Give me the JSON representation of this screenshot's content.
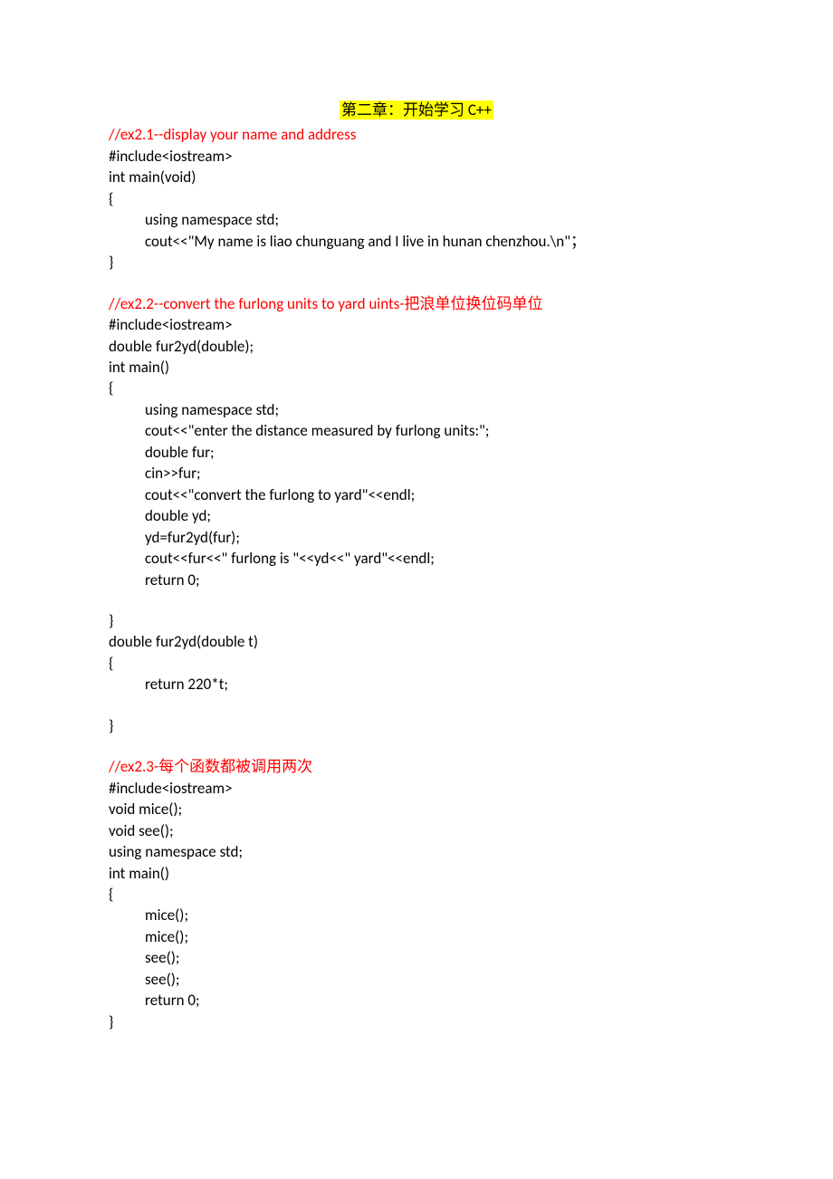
{
  "heading": "第二章：开始学习 C++",
  "sec1": {
    "title": "//ex2.1--display your name and address",
    "l1": "#include<iostream>",
    "l2": "int main(void)",
    "l3": "{",
    "l4": "using namespace std;",
    "l5": "cout<<\"My name is liao chunguang and I live in hunan chenzhou.\\n\"；",
    "l6": "}"
  },
  "sec2": {
    "title": "//ex2.2--convert the furlong units to yard uints-把浪单位换位码单位",
    "l1": "#include<iostream>",
    "l2": "double fur2yd(double);",
    "l3": "int main()",
    "l4": "{",
    "l5": "using namespace std;",
    "l6": "cout<<\"enter the distance measured by furlong units:\";",
    "l7": "double fur;",
    "l8": "cin>>fur;",
    "l9": "cout<<\"convert the furlong to yard\"<<endl;",
    "l10": "double yd;",
    "l11": "yd=fur2yd(fur);",
    "l12": "cout<<fur<<\" furlong is \"<<yd<<\" yard\"<<endl;",
    "l13": "return 0;",
    "l14": "}",
    "l15": "double fur2yd(double t)",
    "l16": "{",
    "l17": "return 220*t;",
    "l18": "}"
  },
  "sec3": {
    "title": "//ex2.3-每个函数都被调用两次",
    "l1": "#include<iostream>",
    "l2": "void mice();",
    "l3": "void see();",
    "l4": "using namespace std;",
    "l5": "int main()",
    "l6": "{",
    "l7": "mice();",
    "l8": "mice();",
    "l9": "see();",
    "l10": "see();",
    "l11": "return 0;",
    "l12": "}"
  }
}
